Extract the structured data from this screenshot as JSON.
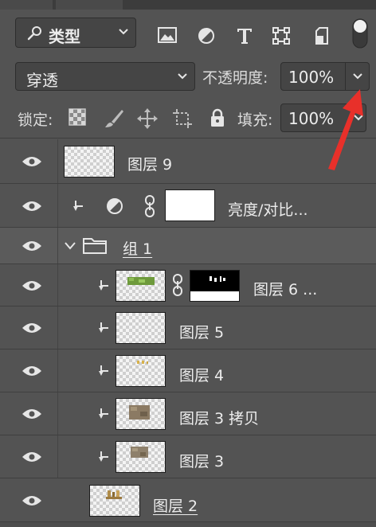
{
  "filter": {
    "kind_label": "类型",
    "icons": [
      "image-filter-icon",
      "adjustment-filter-icon",
      "type-filter-icon",
      "shape-filter-icon",
      "smart-object-filter-icon",
      "filter-toggle-icon"
    ]
  },
  "blend": {
    "mode": "穿透",
    "opacity_label": "不透明度:",
    "opacity_value": "100%"
  },
  "lock": {
    "label": "锁定:",
    "fill_label": "填充:",
    "fill_value": "100%"
  },
  "layers": [
    {
      "name": "图层 9",
      "type": "pixel"
    },
    {
      "name": "亮度/对比...",
      "type": "adjustment",
      "clipped": true
    },
    {
      "name": "组 1",
      "type": "group",
      "expanded": true
    },
    {
      "name": "图层 6 ...",
      "type": "pixel",
      "clipped": true,
      "has_mask": true
    },
    {
      "name": "图层 5",
      "type": "pixel",
      "clipped": true
    },
    {
      "name": "图层 4",
      "type": "pixel",
      "clipped": true
    },
    {
      "name": "图层 3 拷贝",
      "type": "pixel",
      "clipped": true
    },
    {
      "name": "图层 3",
      "type": "pixel",
      "clipped": true
    },
    {
      "name": "图层 2",
      "type": "pixel"
    }
  ],
  "colors": {
    "panel_bg": "#535353",
    "field_bg": "#454545",
    "annotation_arrow": "#e8302a"
  }
}
